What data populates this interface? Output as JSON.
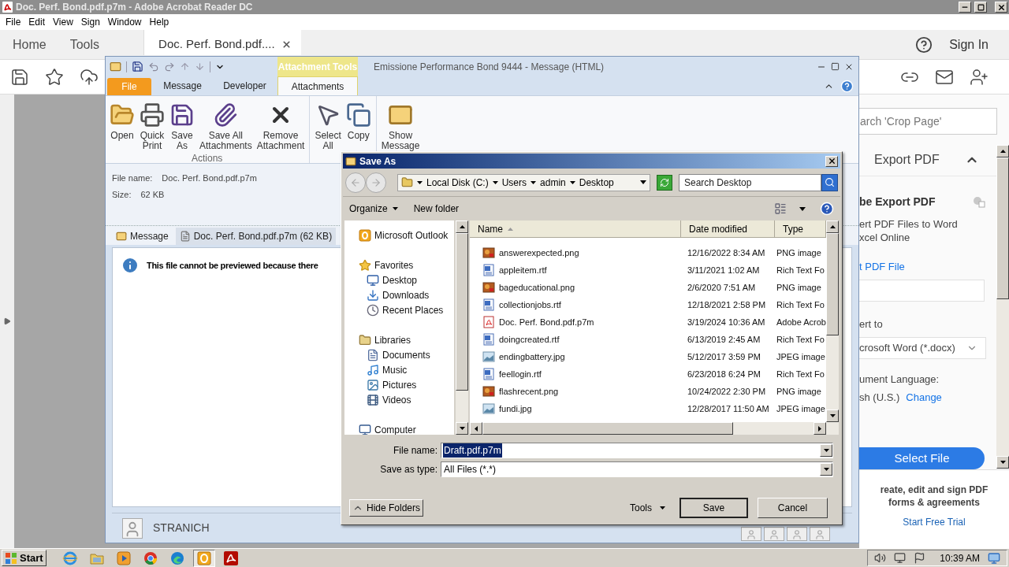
{
  "acrobat": {
    "title": "Doc. Perf. Bond.pdf.p7m - Adobe Acrobat Reader DC",
    "menu": [
      "File",
      "Edit",
      "View",
      "Sign",
      "Window",
      "Help"
    ],
    "tabs": [
      {
        "label": "Home",
        "kind": "nav",
        "selected": false
      },
      {
        "label": "Tools",
        "kind": "nav",
        "selected": false
      },
      {
        "label": "Doc. Perf. Bond.pdf....",
        "kind": "document",
        "selected": true
      }
    ],
    "sign_in": "Sign In",
    "panel": {
      "search_placeholder": "arch 'Crop Page'",
      "section": "Export PDF",
      "expanded": true,
      "heading": "be Export PDF",
      "description": [
        "ert PDF Files to Word",
        "xcel Online"
      ],
      "link": "t PDF File",
      "convert_label": "ert to",
      "format": "crosoft Word (*.docx)",
      "language_label": "ument Language:",
      "language": "sh (U.S.)",
      "change": "Change",
      "button": "Select File",
      "promo": [
        "reate, edit and sign PDF",
        "forms & agreements"
      ],
      "trial": "Start Free Trial"
    }
  },
  "outlook": {
    "title": "Emissione Performance Bond 9444 -  Message (HTML)",
    "context_label": "Attachment Tools",
    "tabs": [
      {
        "label": "File",
        "kind": "file",
        "selected": false
      },
      {
        "label": "Message",
        "kind": "tab",
        "selected": false
      },
      {
        "label": "Developer",
        "kind": "tab",
        "selected": false
      },
      {
        "label": "Attachments",
        "kind": "tab",
        "selected": true
      }
    ],
    "ribbon_groups": [
      {
        "label": "Actions",
        "buttons": [
          {
            "lines": [
              "Open"
            ],
            "kind": "open"
          },
          {
            "lines": [
              "Quick",
              "Print"
            ],
            "kind": "print"
          },
          {
            "lines": [
              "Save",
              "As"
            ],
            "kind": "save"
          },
          {
            "lines": [
              "Save All",
              "Attachments"
            ],
            "kind": "save_all"
          },
          {
            "lines": [
              "Remove",
              "Attachment"
            ],
            "kind": "remove"
          }
        ]
      },
      {
        "buttons": [
          {
            "lines": [
              "Select",
              "All"
            ],
            "kind": "select"
          },
          {
            "lines": [
              "Copy"
            ],
            "kind": "copy"
          }
        ]
      },
      {
        "buttons": [
          {
            "lines": [
              "Show",
              "Message"
            ],
            "kind": "show"
          }
        ]
      }
    ],
    "file_name_label": "File name:",
    "file_name": "Doc. Perf. Bond.pdf.p7m",
    "size_label": "Size:",
    "size": "62 KB",
    "attachment_tabs": [
      {
        "label": "Message",
        "kind": "message",
        "selected": false
      },
      {
        "label": "Doc. Perf. Bond.pdf.p7m (62 KB)",
        "kind": "file",
        "selected": true
      }
    ],
    "preview_message": "This file cannot be previewed because there",
    "sender": "STRANICH"
  },
  "dialog": {
    "title": "Save As",
    "path": [
      "Local Disk (C:)",
      "Users",
      "admin",
      "Desktop"
    ],
    "search_placeholder": "Search Desktop",
    "organize": "Organize",
    "new_folder": "New folder",
    "nav": [
      {
        "label": "Microsoft Outlook",
        "kind": "outlook"
      },
      {
        "label": "Favorites",
        "kind": "favorites",
        "children": [
          {
            "label": "Desktop",
            "kind": "desktop"
          },
          {
            "label": "Downloads",
            "kind": "downloads"
          },
          {
            "label": "Recent Places",
            "kind": "recent"
          }
        ]
      },
      {
        "label": "Libraries",
        "kind": "libraries",
        "children": [
          {
            "label": "Documents",
            "kind": "documents"
          },
          {
            "label": "Music",
            "kind": "music"
          },
          {
            "label": "Pictures",
            "kind": "pictures"
          },
          {
            "label": "Videos",
            "kind": "videos"
          }
        ]
      },
      {
        "label": "Computer",
        "kind": "computer"
      }
    ],
    "columns": [
      {
        "label": "Name",
        "sorted": true
      },
      {
        "label": "Date modified",
        "sorted": false
      },
      {
        "label": "Type",
        "sorted": false
      }
    ],
    "files": [
      {
        "name": "answerexpected.png",
        "kind": "png",
        "date": "12/16/2022 8:34 AM",
        "type": "PNG image"
      },
      {
        "name": "appleitem.rtf",
        "kind": "rtf",
        "date": "3/11/2021 1:02 AM",
        "type": "Rich Text Fo"
      },
      {
        "name": "bageducational.png",
        "kind": "png",
        "date": "2/6/2020 7:51 AM",
        "type": "PNG image"
      },
      {
        "name": "collectionjobs.rtf",
        "kind": "rtf",
        "date": "12/18/2021 2:58 PM",
        "type": "Rich Text Fo"
      },
      {
        "name": "Doc. Perf. Bond.pdf.p7m",
        "kind": "pdf",
        "date": "3/19/2024 10:36 AM",
        "type": "Adobe Acrob"
      },
      {
        "name": "doingcreated.rtf",
        "kind": "rtf",
        "date": "6/13/2019 2:45 AM",
        "type": "Rich Text Fo"
      },
      {
        "name": "endingbattery.jpg",
        "kind": "jpg",
        "date": "5/12/2017 3:59 PM",
        "type": "JPEG image"
      },
      {
        "name": "feellogin.rtf",
        "kind": "rtf",
        "date": "6/23/2018 6:24 PM",
        "type": "Rich Text Fo"
      },
      {
        "name": "flashrecent.png",
        "kind": "png",
        "date": "10/24/2022 2:30 PM",
        "type": "PNG image"
      },
      {
        "name": "fundi.jpg",
        "kind": "jpg",
        "date": "12/28/2017 11:50 AM",
        "type": "JPEG image"
      }
    ],
    "file_name_label": "File name:",
    "file_name": {
      "value": "Draft.pdf.p7m",
      "selected": true
    },
    "type_label": "Save as type:",
    "save_type": "All Files (*.*)",
    "hide_folders": "Hide Folders",
    "tools": "Tools",
    "save": "Save",
    "cancel": "Cancel"
  },
  "taskbar": {
    "start": "Start",
    "apps": [
      {
        "kind": "ie",
        "selected": false
      },
      {
        "kind": "folder",
        "selected": false
      },
      {
        "kind": "media",
        "selected": false
      },
      {
        "kind": "chrome",
        "selected": false
      },
      {
        "kind": "edge",
        "selected": false
      },
      {
        "kind": "outlook",
        "selected": true
      },
      {
        "kind": "acrobat",
        "selected": false
      }
    ],
    "clock": "10:39 AM"
  }
}
